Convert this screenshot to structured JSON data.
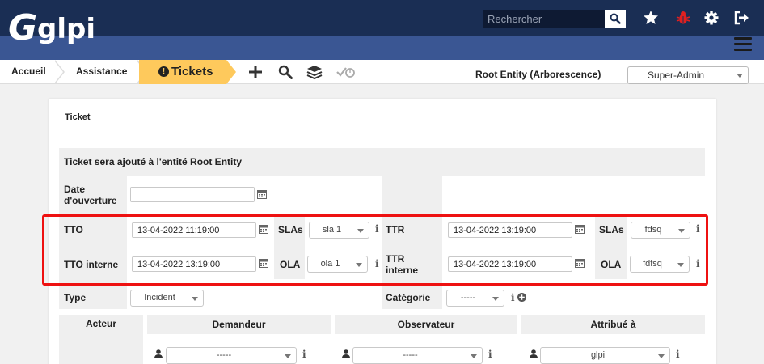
{
  "header": {
    "logo_text": "glpi",
    "search_placeholder": "Rechercher",
    "icons": [
      "search-icon",
      "star-icon",
      "bug-icon",
      "gear-icon",
      "logout-icon",
      "hamburger-icon"
    ],
    "accent_colors": {
      "top": "#1a2e54",
      "bar": "#3a5693",
      "bug": "#e02020"
    }
  },
  "breadcrumb": {
    "items": [
      "Accueil",
      "Assistance",
      "Tickets"
    ],
    "active_color": "#fec95c",
    "tools": [
      "plus-icon",
      "search-icon",
      "layers-icon",
      "check-clock-icon"
    ]
  },
  "entity": {
    "label": "Root Entity (Arborescence)",
    "profile": "Super-Admin"
  },
  "form": {
    "title": "Ticket",
    "entity_notice": "Ticket sera ajouté à l'entité Root Entity",
    "date_ouverture_label": "Date d'ouverture",
    "date_ouverture_value": "",
    "tto_label": "TTO",
    "tto_value": "13-04-2022 11:19:00",
    "tto_slas_label": "SLAs",
    "tto_slas_value": "sla 1",
    "tto_interne_label": "TTO interne",
    "tto_interne_value": "13-04-2022 13:19:00",
    "tto_ola_label": "OLA",
    "tto_ola_value": "ola 1",
    "ttr_label": "TTR",
    "ttr_value": "13-04-2022 13:19:00",
    "ttr_slas_label": "SLAs",
    "ttr_slas_value": "fdsq",
    "ttr_interne_label": "TTR interne",
    "ttr_interne_value": "13-04-2022 13:19:00",
    "ttr_ola_label": "OLA",
    "ttr_ola_value": "fdfsq",
    "type_label": "Type",
    "type_value": "Incident",
    "categorie_label": "Catégorie",
    "categorie_value": "-----",
    "actors": {
      "acteur_label": "Acteur",
      "demandeur_label": "Demandeur",
      "demandeur_value": "-----",
      "observateur_label": "Observateur",
      "observateur_value": "-----",
      "attribue_label": "Attribué à",
      "attribue_value": "glpi"
    }
  }
}
